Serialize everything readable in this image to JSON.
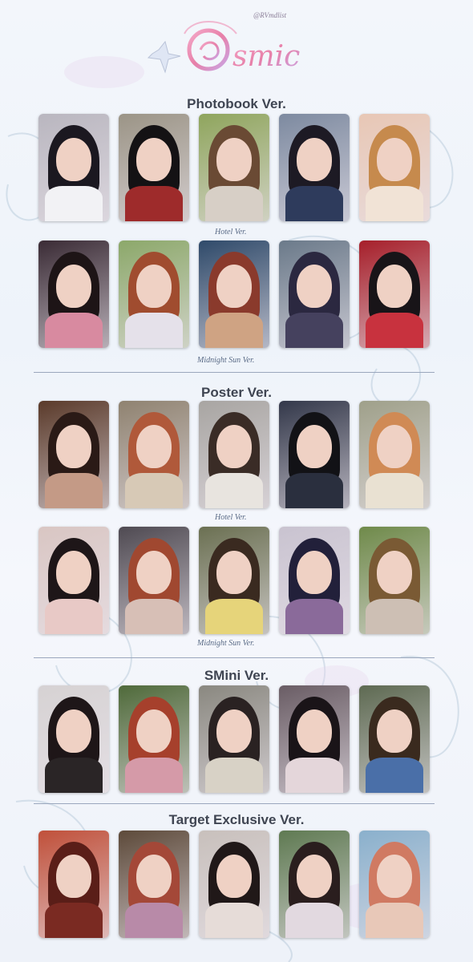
{
  "header": {
    "logo_text": "Cosmic",
    "watermark": "@RVmdlist"
  },
  "sections": [
    {
      "title": "Photobook Ver.",
      "row_labels": [
        "Hotel Ver.",
        "Midnight Sun Ver."
      ],
      "rows": [
        [
          {
            "hair": "#1b1820",
            "bg": "#b9b6bf",
            "outfit": "#f2f2f5"
          },
          {
            "hair": "#141214",
            "bg": "#9b9486",
            "outfit": "#9e2b2b"
          },
          {
            "hair": "#6a4a34",
            "bg": "#8fa55d",
            "outfit": "#d7cfc6"
          },
          {
            "hair": "#1d1a24",
            "bg": "#7d8aa0",
            "outfit": "#2e3b5c"
          },
          {
            "hair": "#c68a4d",
            "bg": "#e8c7b5",
            "outfit": "#f1e3d6"
          }
        ],
        [
          {
            "hair": "#1d1416",
            "bg": "#3a2b35",
            "outfit": "#d88aa0"
          },
          {
            "hair": "#a04c2f",
            "bg": "#8ca86a",
            "outfit": "#e5e1ea"
          },
          {
            "hair": "#8a3a2c",
            "bg": "#2f4a6a",
            "outfit": "#cfa383"
          },
          {
            "hair": "#2b2840",
            "bg": "#6b7a8a",
            "outfit": "#45415e"
          },
          {
            "hair": "#181418",
            "bg": "#a61f2a",
            "outfit": "#c8323e"
          }
        ]
      ]
    },
    {
      "title": "Poster Ver.",
      "row_labels": [
        "Hotel Ver.",
        "Midnight Sun Ver."
      ],
      "rows": [
        [
          {
            "hair": "#2a1a16",
            "bg": "#5a3a2a",
            "outfit": "#c49a86"
          },
          {
            "hair": "#b0593a",
            "bg": "#8f8270",
            "outfit": "#d7c9b6"
          },
          {
            "hair": "#3a2c26",
            "bg": "#a8a5a2",
            "outfit": "#e8e4df"
          },
          {
            "hair": "#121216",
            "bg": "#33384a",
            "outfit": "#2a2f3e"
          },
          {
            "hair": "#d08a55",
            "bg": "#9fa08a",
            "outfit": "#e9e1d2"
          }
        ],
        [
          {
            "hair": "#1e1618",
            "bg": "#d9c6c3",
            "outfit": "#e8c9c6"
          },
          {
            "hair": "#a04830",
            "bg": "#4f4a52",
            "outfit": "#d7bfb6"
          },
          {
            "hair": "#3a2a20",
            "bg": "#6b7052",
            "outfit": "#e6d47a"
          },
          {
            "hair": "#22203a",
            "bg": "#c9c3d0",
            "outfit": "#8a6a9a"
          },
          {
            "hair": "#7a5a34",
            "bg": "#6f8a4a",
            "outfit": "#cdbfb4"
          }
        ]
      ]
    },
    {
      "title": "SMini Ver.",
      "row_labels": [],
      "rows": [
        [
          {
            "hair": "#1e1618",
            "bg": "#d6d2d3",
            "outfit": "#2a2526"
          },
          {
            "hair": "#a6402c",
            "bg": "#4f6a3a",
            "outfit": "#d59aa8"
          },
          {
            "hair": "#2a2222",
            "bg": "#8a8880",
            "outfit": "#d8d2c6"
          },
          {
            "hair": "#1a1418",
            "bg": "#6a5d65",
            "outfit": "#e4d6da"
          },
          {
            "hair": "#3a2a1e",
            "bg": "#5e6a52",
            "outfit": "#4a6fa8"
          }
        ]
      ]
    },
    {
      "title": "Target Exclusive Ver.",
      "row_labels": [],
      "rows": [
        [
          {
            "hair": "#5a1e18",
            "bg": "#c0503a",
            "outfit": "#7a2a22"
          },
          {
            "hair": "#a44838",
            "bg": "#5d4a3a",
            "outfit": "#b88aa8"
          },
          {
            "hair": "#201818",
            "bg": "#c8c0bc",
            "outfit": "#e6dcd8"
          },
          {
            "hair": "#2a1e1e",
            "bg": "#5f7a52",
            "outfit": "#e2d9e0"
          },
          {
            "hair": "#d07a62",
            "bg": "#8ab0cc",
            "outfit": "#e8c8b8"
          }
        ]
      ]
    }
  ]
}
